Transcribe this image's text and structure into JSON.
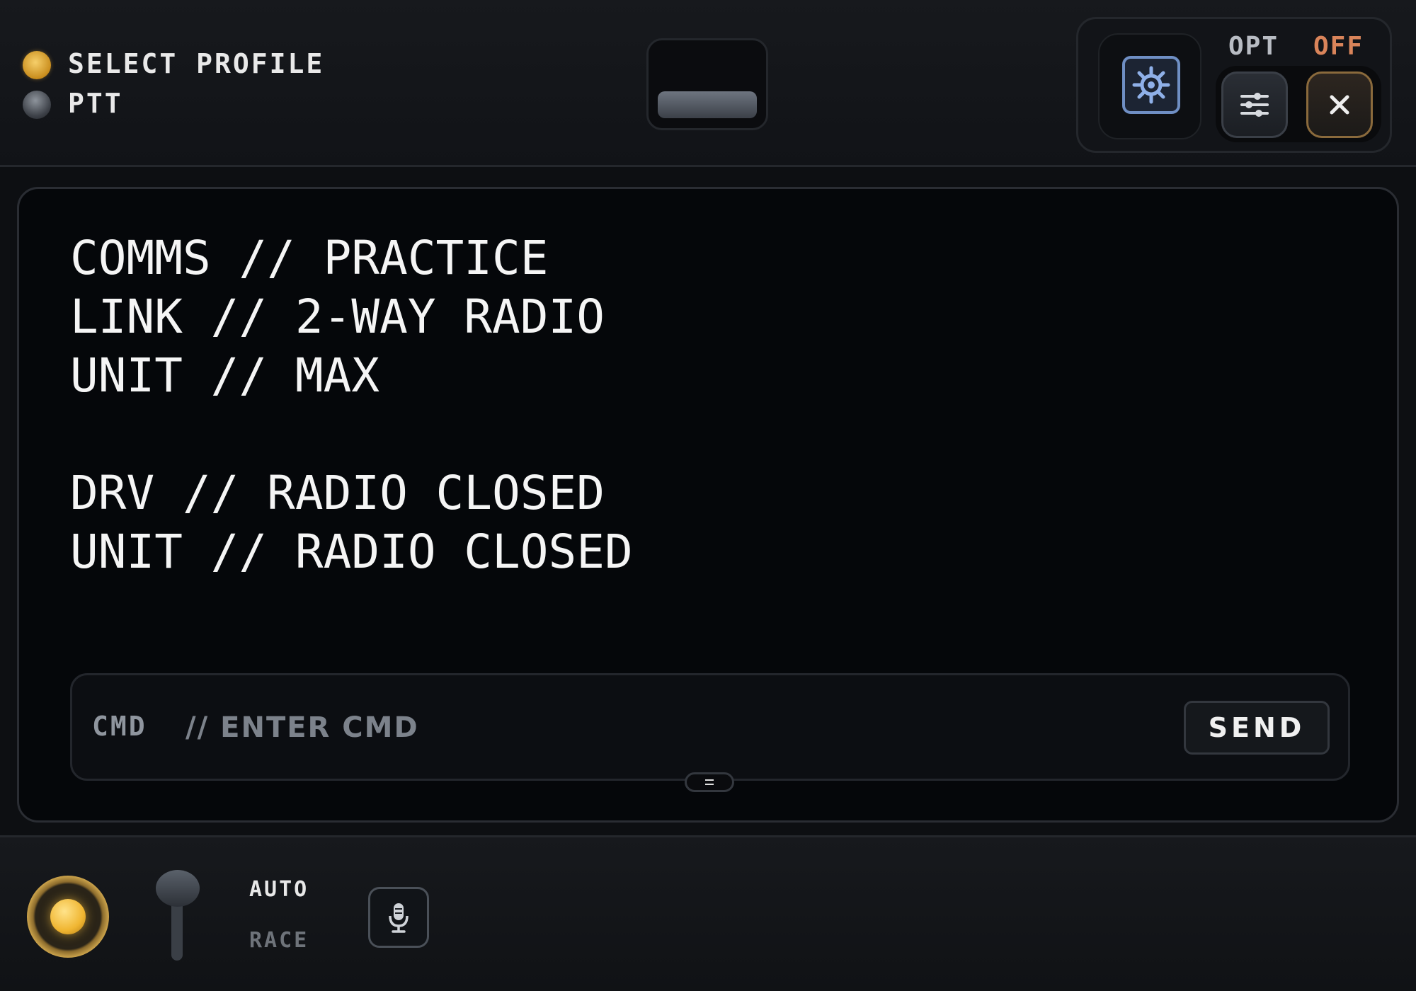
{
  "header": {
    "indicators": [
      {
        "label": "SELECT PROFILE",
        "color": "#e2a83a"
      },
      {
        "label": "PTT",
        "color": "#5a5f66"
      }
    ],
    "opt_label": "OPT",
    "off_label": "OFF",
    "accent_blue": "#6f8fc4",
    "accent_orange": "#d9845a",
    "icons": [
      "gear-icon",
      "sliders-icon",
      "close-icon"
    ]
  },
  "console": {
    "lines": [
      "COMMS // PRACTICE",
      "LINK // 2-WAY RADIO",
      "UNIT // MAX",
      "",
      "DRV // RADIO CLOSED",
      "UNIT // RADIO CLOSED"
    ]
  },
  "command": {
    "label": "CMD",
    "placeholder": "// ENTER CMD",
    "value": "",
    "send_label": "SEND",
    "grip_glyph": "="
  },
  "footer": {
    "mode_auto": "AUTO",
    "mode_race": "RACE",
    "knob_color": "#f0b632",
    "icons": [
      "microphone-icon"
    ]
  }
}
